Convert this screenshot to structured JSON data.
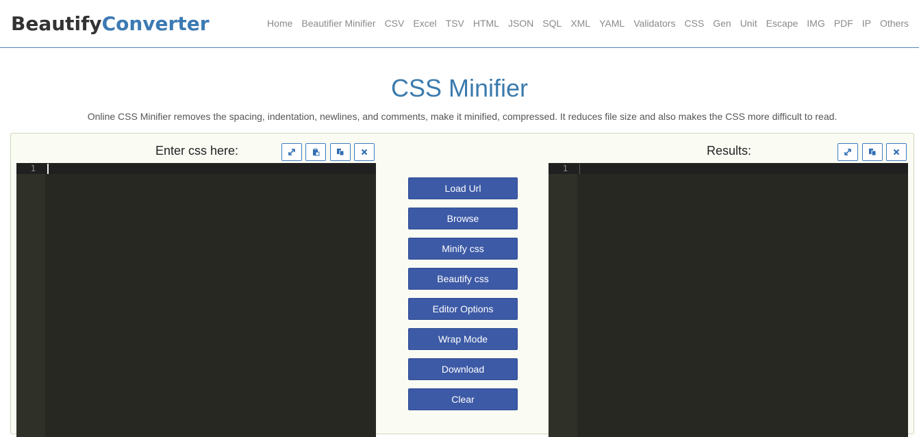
{
  "logo": {
    "part1": "Beautify",
    "part2": "Converter"
  },
  "nav": [
    "Home",
    "Beautifier Minifier",
    "CSV",
    "Excel",
    "TSV",
    "HTML",
    "JSON",
    "SQL",
    "XML",
    "YAML",
    "Validators",
    "CSS",
    "Gen",
    "Unit",
    "Escape",
    "IMG",
    "PDF",
    "IP",
    "Others"
  ],
  "page": {
    "title": "CSS Minifier",
    "description": "Online CSS Minifier removes the spacing, indentation, newlines, and comments, make it minified, compressed. It reduces file size and also makes the CSS more difficult to read."
  },
  "input_pane": {
    "label": "Enter css here:",
    "line_number": "1",
    "tools": [
      "expand-icon",
      "paste-icon",
      "copy-icon",
      "clear-icon"
    ]
  },
  "output_pane": {
    "label": "Results:",
    "line_number": "1",
    "tools": [
      "expand-icon",
      "copy-icon",
      "clear-icon"
    ]
  },
  "actions": {
    "load_url": "Load Url",
    "browse": "Browse",
    "minify": "Minify css",
    "beautify": "Beautify css",
    "editor_options": "Editor Options",
    "wrap_mode": "Wrap Mode",
    "download": "Download",
    "clear": "Clear"
  },
  "colors": {
    "accent": "#3b7bad",
    "button": "#3d5aa6",
    "editor_bg": "#272822"
  }
}
